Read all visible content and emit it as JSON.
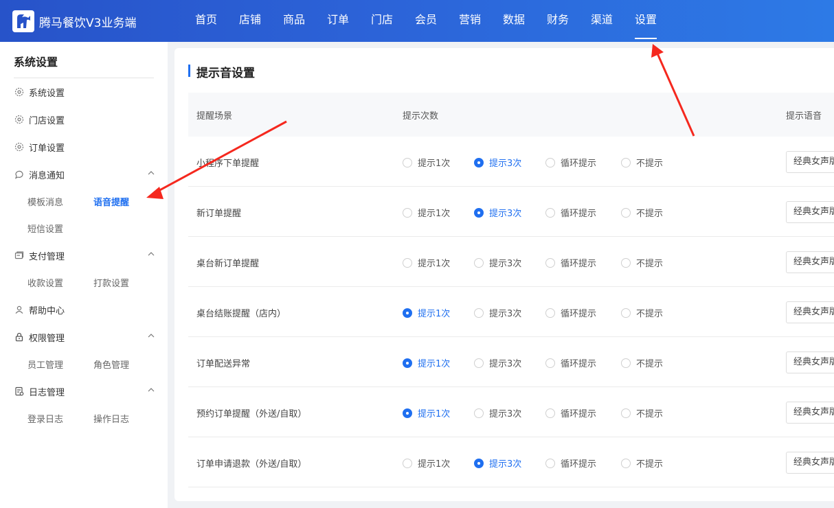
{
  "app": {
    "title": "腾马餐饮V3业务端"
  },
  "nav": [
    "首页",
    "店铺",
    "商品",
    "订单",
    "门店",
    "会员",
    "营销",
    "数据",
    "财务",
    "渠道",
    "设置"
  ],
  "sidebar": {
    "title": "系统设置",
    "items": [
      {
        "label": "系统设置",
        "icon": "gear-icon"
      },
      {
        "label": "门店设置",
        "icon": "gear-icon"
      },
      {
        "label": "订单设置",
        "icon": "gear-icon"
      },
      {
        "label": "消息通知",
        "icon": "chat-bubble-icon",
        "children": [
          "模板消息",
          "语音提醒",
          "短信设置"
        ]
      },
      {
        "label": "支付管理",
        "icon": "wallet-icon",
        "children": [
          "收款设置",
          "打款设置"
        ]
      },
      {
        "label": "帮助中心",
        "icon": "user-icon"
      },
      {
        "label": "权限管理",
        "icon": "lock-icon",
        "children": [
          "员工管理",
          "角色管理"
        ]
      },
      {
        "label": "日志管理",
        "icon": "log-icon",
        "children": [
          "登录日志",
          "操作日志"
        ]
      }
    ],
    "active_sub": "语音提醒"
  },
  "main": {
    "title": "提示音设置",
    "columns": {
      "scene": "提醒场景",
      "count": "提示次数",
      "voice": "提示语音"
    },
    "options": [
      "提示1次",
      "提示3次",
      "循环提示",
      "不提示"
    ],
    "voice_value": "经典女声版",
    "rows": [
      {
        "scene": "小程序下单提醒",
        "selected": 1
      },
      {
        "scene": "新订单提醒",
        "selected": 1
      },
      {
        "scene": "桌台新订单提醒",
        "selected": -1
      },
      {
        "scene": "桌台结账提醒（店内）",
        "selected": 0
      },
      {
        "scene": "订单配送异常",
        "selected": 0
      },
      {
        "scene": "预约订单提醒（外送/自取）",
        "selected": 0
      },
      {
        "scene": "订单申请退款（外送/自取）",
        "selected": 1
      }
    ]
  },
  "colors": {
    "accent": "#1f6ff0",
    "header": "#2c63d8",
    "annotation": "#f5281e"
  }
}
